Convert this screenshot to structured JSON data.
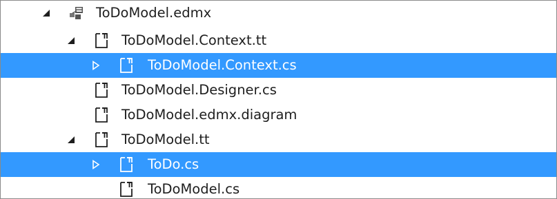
{
  "tree": {
    "items": [
      {
        "label": "ToDoModel.edmx",
        "icon": "edmx-model-icon",
        "expander": "expanded-triangle-icon",
        "selected": false
      },
      {
        "label": "ToDoModel.Context.tt",
        "icon": "file-template-icon",
        "expander": "expanded-triangle-icon",
        "selected": false
      },
      {
        "label": "ToDoModel.Context.cs",
        "icon": "file-template-icon",
        "expander": "collapsed-triangle-icon",
        "selected": true
      },
      {
        "label": "ToDoModel.Designer.cs",
        "icon": "file-template-icon",
        "expander": "",
        "selected": false
      },
      {
        "label": "ToDoModel.edmx.diagram",
        "icon": "file-template-icon",
        "expander": "",
        "selected": false
      },
      {
        "label": "ToDoModel.tt",
        "icon": "file-template-icon",
        "expander": "expanded-triangle-icon",
        "selected": false
      },
      {
        "label": "ToDo.cs",
        "icon": "file-template-icon",
        "expander": "collapsed-triangle-icon",
        "selected": true
      },
      {
        "label": "ToDoModel.cs",
        "icon": "file-template-icon",
        "expander": "",
        "selected": false
      }
    ]
  },
  "colors": {
    "selection": "#3399ff",
    "selected_text": "#ffffff",
    "text": "#1e1e1e",
    "border": "#8a8a8a"
  }
}
